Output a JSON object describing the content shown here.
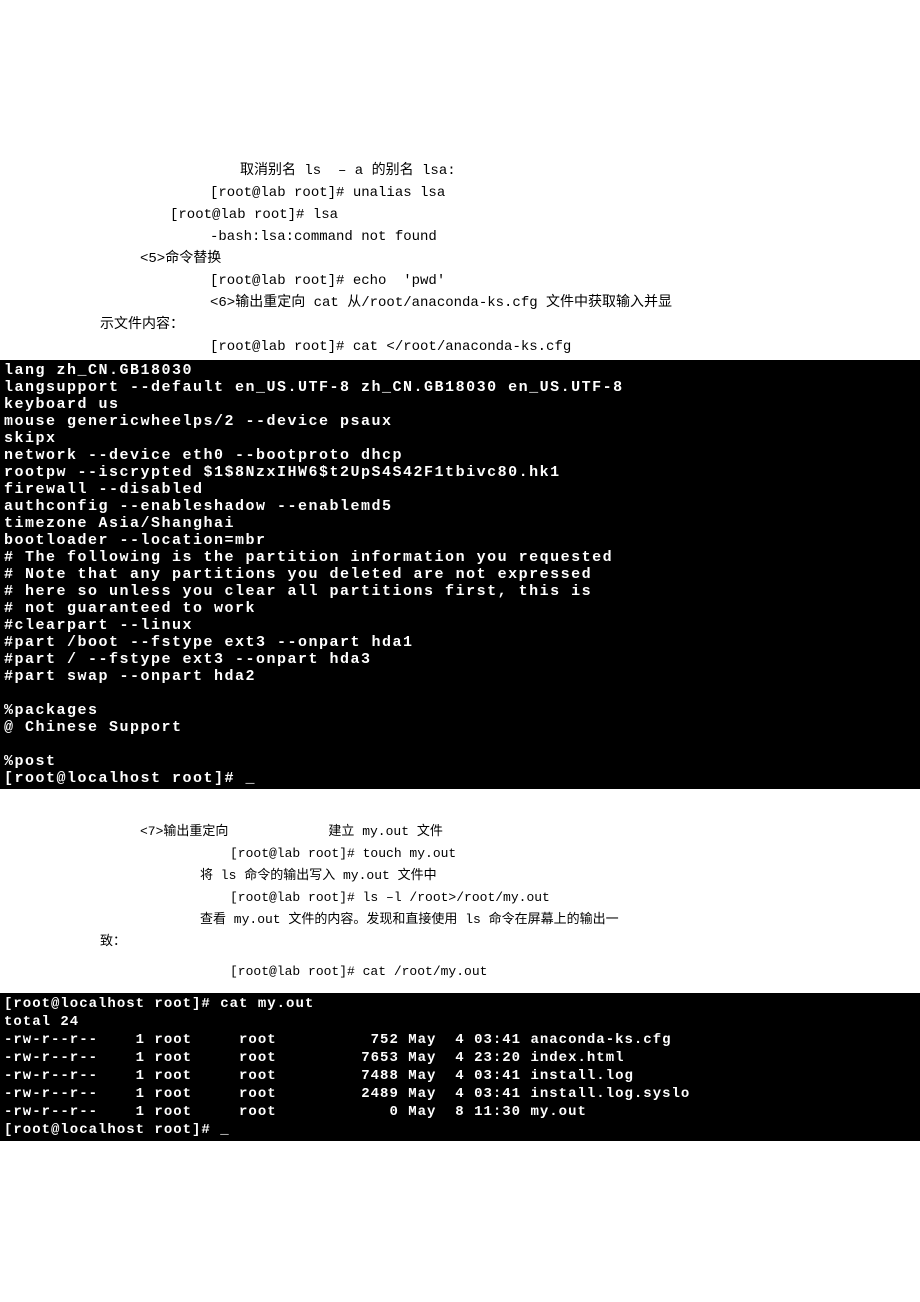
{
  "doc": {
    "l1": "取消别名 ls  – a 的别名 lsa:",
    "l2": "[root@lab root]# unalias lsa",
    "l3": "[root@lab root]# lsa",
    "l4": "-bash:lsa:command not found",
    "l5": "<5>命令替换",
    "l6": "[root@lab root]# echo  'pwd'",
    "l7": "<6>输出重定向 cat 从/root/anaconda-ks.cfg 文件中获取输入并显",
    "l8": "示文件内容：",
    "l9": "[root@lab root]# cat </root/anaconda-ks.cfg"
  },
  "term1": {
    "r1": "lang zh_CN.GB18030",
    "r2": "langsupport --default en_US.UTF-8 zh_CN.GB18030 en_US.UTF-8",
    "r3": "keyboard us",
    "r4": "mouse genericwheelps/2 --device psaux",
    "r5": "skipx",
    "r6": "network --device eth0 --bootproto dhcp",
    "r7": "rootpw --iscrypted $1$8NzxIHW6$t2UpS4S42F1tbivc80.hk1",
    "r8": "firewall --disabled",
    "r9": "authconfig --enableshadow --enablemd5",
    "r10": "timezone Asia/Shanghai",
    "r11": "bootloader --location=mbr",
    "r12": "# The following is the partition information you requested",
    "r13": "# Note that any partitions you deleted are not expressed",
    "r14": "# here so unless you clear all partitions first, this is",
    "r15": "# not guaranteed to work",
    "r16": "#clearpart --linux",
    "r17": "#part /boot --fstype ext3 --onpart hda1",
    "r18": "#part / --fstype ext3 --onpart hda3",
    "r19": "#part swap --onpart hda2",
    "r20": " ",
    "r21": "%packages",
    "r22": "@ Chinese Support",
    "r23": " ",
    "r24": "%post",
    "r25": "[root@localhost root]# _"
  },
  "doc2": {
    "l1a": "<7>输出重定向",
    "l1b": "建立 my.out 文件",
    "l2": "[root@lab root]# touch my.out",
    "l3": "将 ls 命令的输出写入 my.out 文件中",
    "l4": "[root@lab root]# ls –l /root>/root/my.out",
    "l5": "查看 my.out 文件的内容。发现和直接使用 ls 命令在屏幕上的输出一",
    "l6": "致：",
    "l7": "[root@lab root]# cat /root/my.out"
  },
  "term2": {
    "r1": "[root@localhost root]# cat my.out",
    "r2": "total 24",
    "r3": "-rw-r--r--    1 root     root          752 May  4 03:41 anaconda-ks.cfg",
    "r4": "-rw-r--r--    1 root     root         7653 May  4 23:20 index.html",
    "r5": "-rw-r--r--    1 root     root         7488 May  4 03:41 install.log",
    "r6": "-rw-r--r--    1 root     root         2489 May  4 03:41 install.log.syslo",
    "r7": "-rw-r--r--    1 root     root            0 May  8 11:30 my.out",
    "r8": "[root@localhost root]# _"
  }
}
